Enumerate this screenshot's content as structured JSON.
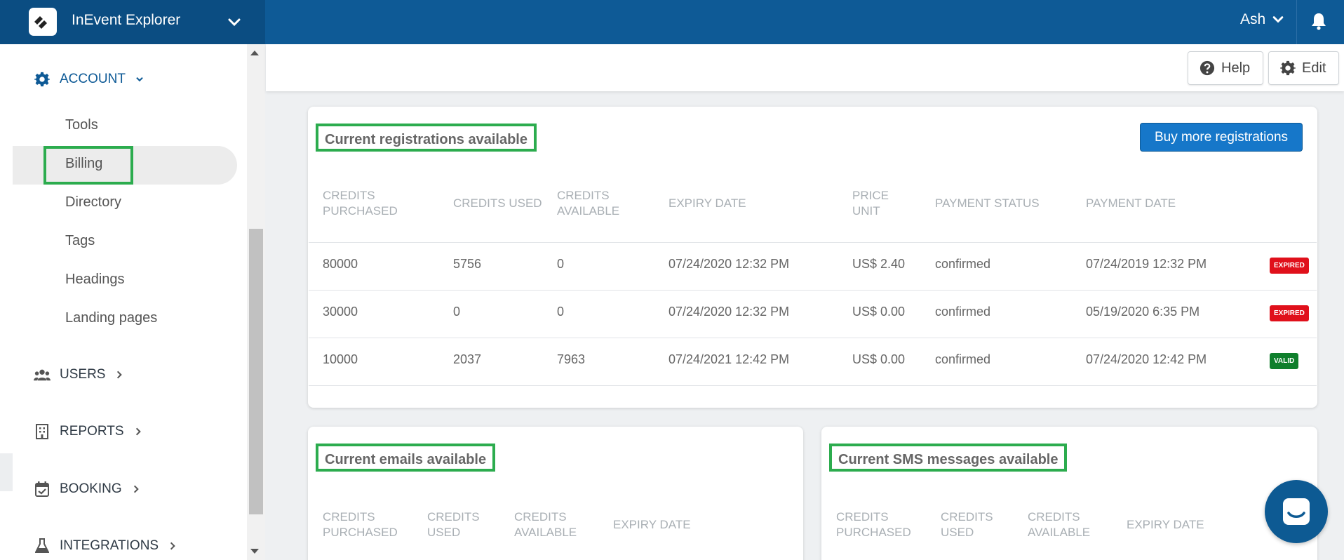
{
  "header": {
    "app_title": "InEvent Explorer",
    "logo_text": "InEvent",
    "user_name": "Ash"
  },
  "sidebar": {
    "account_label": "ACCOUNT",
    "account_items": [
      "Tools",
      "Billing",
      "Directory",
      "Tags",
      "Headings",
      "Landing pages"
    ],
    "users_label": "USERS",
    "reports_label": "REPORTS",
    "booking_label": "BOOKING",
    "integrations_label": "INTEGRATIONS"
  },
  "toolbar": {
    "help_label": "Help",
    "edit_label": "Edit"
  },
  "registrations": {
    "title": "Current registrations available",
    "buy_button": "Buy more registrations",
    "columns": [
      "CREDITS PURCHASED",
      "CREDITS USED",
      "CREDITS AVAILABLE",
      "EXPIRY DATE",
      "PRICE UNIT",
      "PAYMENT STATUS",
      "PAYMENT DATE"
    ],
    "rows": [
      {
        "purchased": "80000",
        "used": "5756",
        "available": "0",
        "expiry": "07/24/2020 12:32 PM",
        "price": "US$ 2.40",
        "status": "confirmed",
        "date": "07/24/2019 12:32 PM",
        "badge": "EXPIRED"
      },
      {
        "purchased": "30000",
        "used": "0",
        "available": "0",
        "expiry": "07/24/2020 12:32 PM",
        "price": "US$ 0.00",
        "status": "confirmed",
        "date": "05/19/2020 6:35 PM",
        "badge": "EXPIRED"
      },
      {
        "purchased": "10000",
        "used": "2037",
        "available": "7963",
        "expiry": "07/24/2021 12:42 PM",
        "price": "US$ 0.00",
        "status": "confirmed",
        "date": "07/24/2020 12:42 PM",
        "badge": "VALID"
      }
    ]
  },
  "emails": {
    "title": "Current emails available",
    "columns": [
      "CREDITS PURCHASED",
      "CREDITS USED",
      "CREDITS AVAILABLE",
      "EXPIRY DATE"
    ]
  },
  "sms": {
    "title": "Current SMS messages available",
    "columns": [
      "CREDITS PURCHASED",
      "CREDITS USED",
      "CREDITS AVAILABLE",
      "EXPIRY DATE"
    ]
  },
  "colors": {
    "topbar": "#0e5a96",
    "accent_green": "#2cac4e",
    "primary": "#1677c9",
    "expired": "#e0101b",
    "valid": "#0f7f2c"
  }
}
